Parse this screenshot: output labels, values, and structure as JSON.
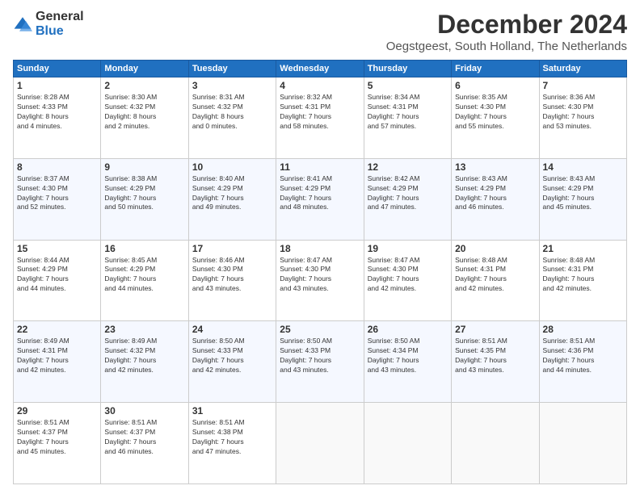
{
  "logo": {
    "general": "General",
    "blue": "Blue"
  },
  "title": "December 2024",
  "subtitle": "Oegstgeest, South Holland, The Netherlands",
  "days_header": [
    "Sunday",
    "Monday",
    "Tuesday",
    "Wednesday",
    "Thursday",
    "Friday",
    "Saturday"
  ],
  "weeks": [
    [
      {
        "day": "1",
        "sunrise": "8:28 AM",
        "sunset": "4:33 PM",
        "daylight": "8 hours and 4 minutes."
      },
      {
        "day": "2",
        "sunrise": "8:30 AM",
        "sunset": "4:32 PM",
        "daylight": "8 hours and 2 minutes."
      },
      {
        "day": "3",
        "sunrise": "8:31 AM",
        "sunset": "4:32 PM",
        "daylight": "8 hours and 0 minutes."
      },
      {
        "day": "4",
        "sunrise": "8:32 AM",
        "sunset": "4:31 PM",
        "daylight": "7 hours and 58 minutes."
      },
      {
        "day": "5",
        "sunrise": "8:34 AM",
        "sunset": "4:31 PM",
        "daylight": "7 hours and 57 minutes."
      },
      {
        "day": "6",
        "sunrise": "8:35 AM",
        "sunset": "4:30 PM",
        "daylight": "7 hours and 55 minutes."
      },
      {
        "day": "7",
        "sunrise": "8:36 AM",
        "sunset": "4:30 PM",
        "daylight": "7 hours and 53 minutes."
      }
    ],
    [
      {
        "day": "8",
        "sunrise": "8:37 AM",
        "sunset": "4:30 PM",
        "daylight": "7 hours and 52 minutes."
      },
      {
        "day": "9",
        "sunrise": "8:38 AM",
        "sunset": "4:29 PM",
        "daylight": "7 hours and 50 minutes."
      },
      {
        "day": "10",
        "sunrise": "8:40 AM",
        "sunset": "4:29 PM",
        "daylight": "7 hours and 49 minutes."
      },
      {
        "day": "11",
        "sunrise": "8:41 AM",
        "sunset": "4:29 PM",
        "daylight": "7 hours and 48 minutes."
      },
      {
        "day": "12",
        "sunrise": "8:42 AM",
        "sunset": "4:29 PM",
        "daylight": "7 hours and 47 minutes."
      },
      {
        "day": "13",
        "sunrise": "8:43 AM",
        "sunset": "4:29 PM",
        "daylight": "7 hours and 46 minutes."
      },
      {
        "day": "14",
        "sunrise": "8:43 AM",
        "sunset": "4:29 PM",
        "daylight": "7 hours and 45 minutes."
      }
    ],
    [
      {
        "day": "15",
        "sunrise": "8:44 AM",
        "sunset": "4:29 PM",
        "daylight": "7 hours and 44 minutes."
      },
      {
        "day": "16",
        "sunrise": "8:45 AM",
        "sunset": "4:29 PM",
        "daylight": "7 hours and 44 minutes."
      },
      {
        "day": "17",
        "sunrise": "8:46 AM",
        "sunset": "4:30 PM",
        "daylight": "7 hours and 43 minutes."
      },
      {
        "day": "18",
        "sunrise": "8:47 AM",
        "sunset": "4:30 PM",
        "daylight": "7 hours and 43 minutes."
      },
      {
        "day": "19",
        "sunrise": "8:47 AM",
        "sunset": "4:30 PM",
        "daylight": "7 hours and 42 minutes."
      },
      {
        "day": "20",
        "sunrise": "8:48 AM",
        "sunset": "4:31 PM",
        "daylight": "7 hours and 42 minutes."
      },
      {
        "day": "21",
        "sunrise": "8:48 AM",
        "sunset": "4:31 PM",
        "daylight": "7 hours and 42 minutes."
      }
    ],
    [
      {
        "day": "22",
        "sunrise": "8:49 AM",
        "sunset": "4:31 PM",
        "daylight": "7 hours and 42 minutes."
      },
      {
        "day": "23",
        "sunrise": "8:49 AM",
        "sunset": "4:32 PM",
        "daylight": "7 hours and 42 minutes."
      },
      {
        "day": "24",
        "sunrise": "8:50 AM",
        "sunset": "4:33 PM",
        "daylight": "7 hours and 42 minutes."
      },
      {
        "day": "25",
        "sunrise": "8:50 AM",
        "sunset": "4:33 PM",
        "daylight": "7 hours and 43 minutes."
      },
      {
        "day": "26",
        "sunrise": "8:50 AM",
        "sunset": "4:34 PM",
        "daylight": "7 hours and 43 minutes."
      },
      {
        "day": "27",
        "sunrise": "8:51 AM",
        "sunset": "4:35 PM",
        "daylight": "7 hours and 43 minutes."
      },
      {
        "day": "28",
        "sunrise": "8:51 AM",
        "sunset": "4:36 PM",
        "daylight": "7 hours and 44 minutes."
      }
    ],
    [
      {
        "day": "29",
        "sunrise": "8:51 AM",
        "sunset": "4:37 PM",
        "daylight": "7 hours and 45 minutes."
      },
      {
        "day": "30",
        "sunrise": "8:51 AM",
        "sunset": "4:37 PM",
        "daylight": "7 hours and 46 minutes."
      },
      {
        "day": "31",
        "sunrise": "8:51 AM",
        "sunset": "4:38 PM",
        "daylight": "7 hours and 47 minutes."
      },
      null,
      null,
      null,
      null
    ]
  ]
}
